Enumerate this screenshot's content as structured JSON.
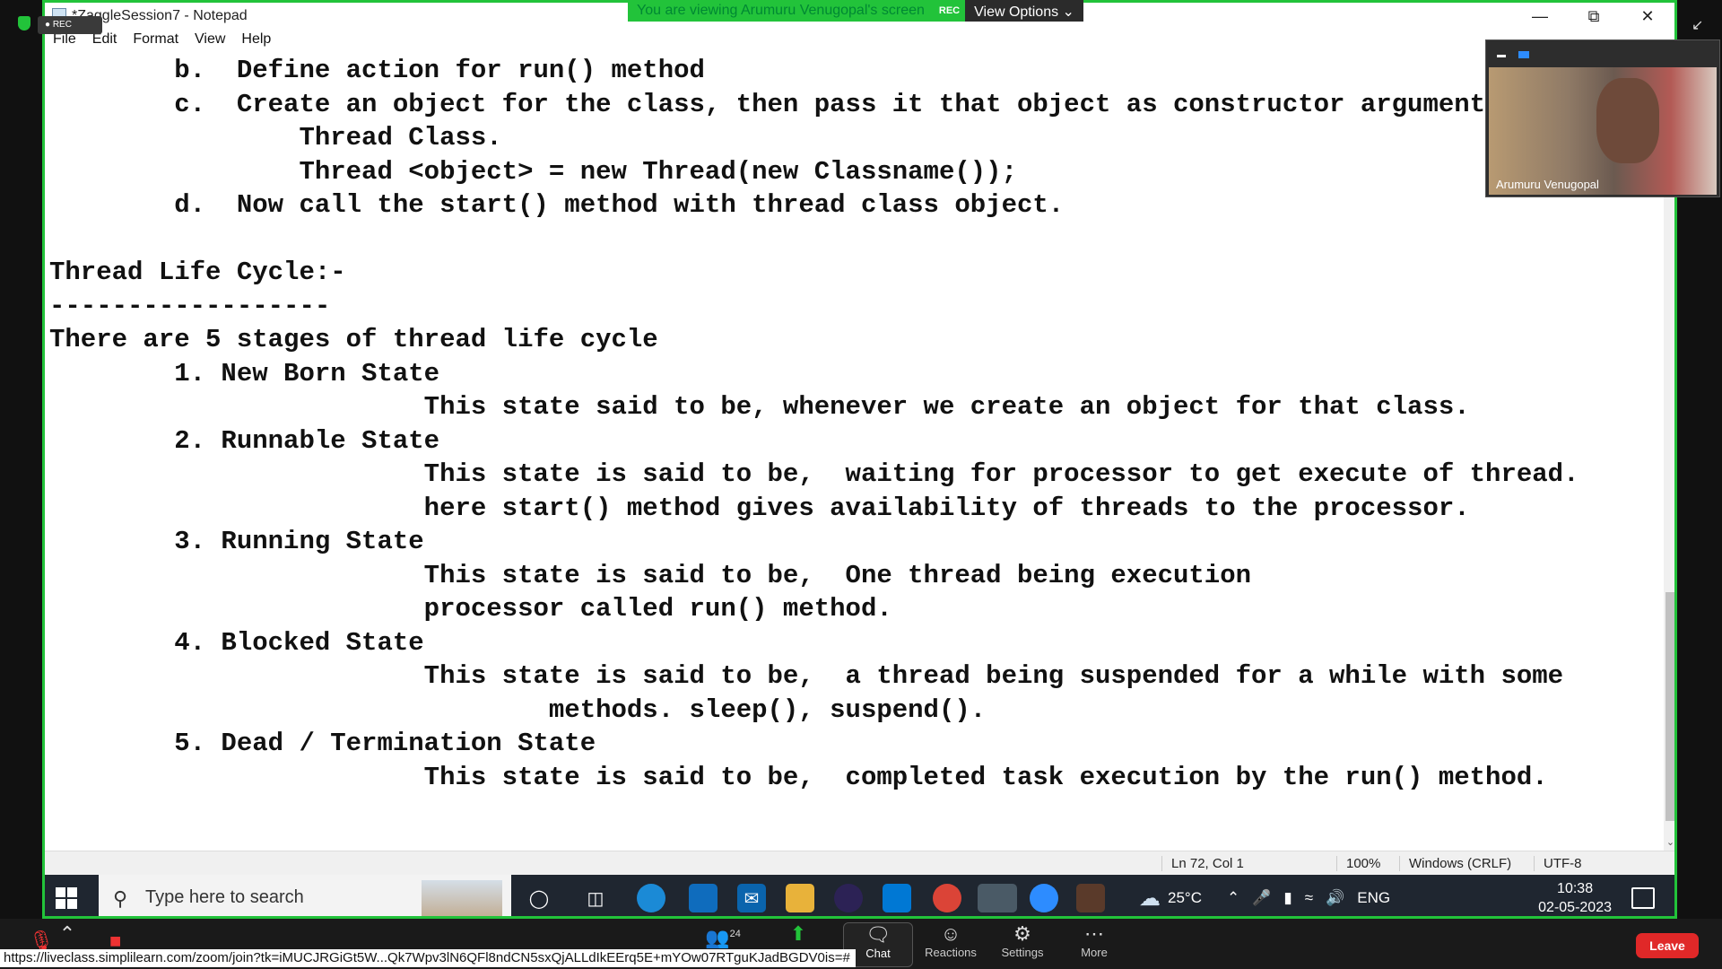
{
  "notepad": {
    "title": "*ZaggleSession7 - Notepad",
    "menu": [
      "File",
      "Edit",
      "Format",
      "View",
      "Help"
    ],
    "lines": [
      "        b.  Define action for run() method",
      "        c.  Create an object for the class, then pass it that object as constructor argument",
      "                Thread Class.",
      "                Thread <object> = new Thread(new Classname());",
      "        d.  Now call the start() method with thread class object.",
      "",
      "Thread Life Cycle:-",
      "------------------",
      "There are 5 stages of thread life cycle",
      "        1. New Born State",
      "                        This state said to be, whenever we create an object for that class.",
      "        2. Runnable State",
      "                        This state is said to be,  waiting for processor to get execute of thread.",
      "                        here start() method gives availability of threads to the processor.",
      "        3. Running State",
      "                        This state is said to be,  One thread being execution",
      "                        processor called run() method.",
      "        4. Blocked State",
      "                        This state is said to be,  a thread being suspended for a while with some",
      "                                methods. sleep(), suspend().",
      "        5. Dead / Termination State",
      "                        This state is said to be,  completed task execution by the run() method."
    ],
    "status": {
      "position": "Ln 72, Col 1",
      "zoom": "100%",
      "line_ending": "Windows (CRLF)",
      "encoding": "UTF-8"
    }
  },
  "zoom": {
    "viewing_banner": "You are viewing Arumuru Venugopal's screen",
    "rec_label": "REC",
    "view_options": "View Options",
    "rec_badge": "REC",
    "participant_name": "Arumuru Venugopal",
    "participants_count": "24",
    "toolbar": [
      "Chat",
      "Reactions",
      "Settings",
      "More"
    ],
    "leave": "Leave",
    "url": "https://liveclass.simplilearn.com/zoom/join?tk=iMUCJRGiGt5W...Qk7Wpv3lN6QFl8ndCN5sxQjALLdIkEErq5E+mYOw07RTguKJadBGDV0is=#"
  },
  "taskbar": {
    "search_placeholder": "Type here to search",
    "weather": "25°C",
    "language": "ENG",
    "time": "10:38",
    "date": "02-05-2023"
  },
  "colors": {
    "share_border": "#22c33a",
    "leave_button": "#e02828",
    "taskbar": "#1f2630"
  }
}
